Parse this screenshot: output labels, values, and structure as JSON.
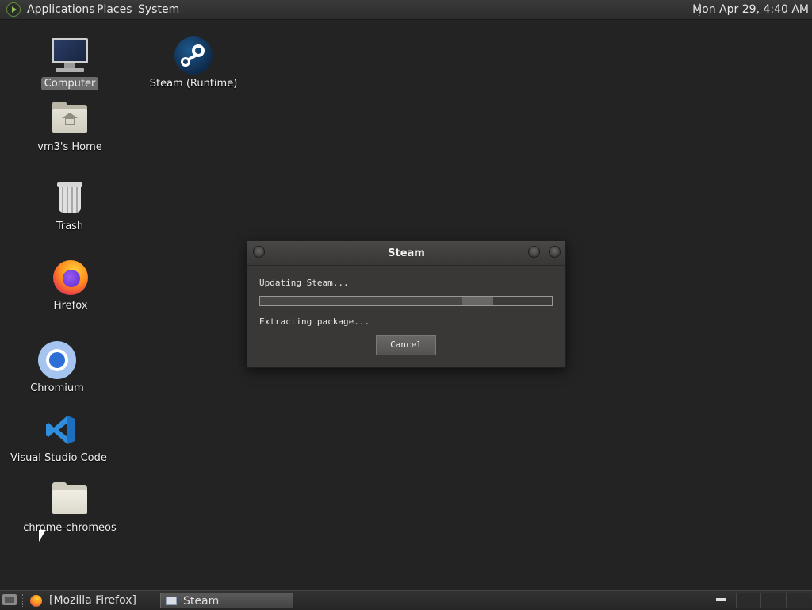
{
  "top_panel": {
    "menus": [
      "Applications",
      "Places",
      "System"
    ],
    "clock": "Mon Apr 29,  4:40 AM"
  },
  "desktop": {
    "icons": [
      {
        "label": "Computer",
        "icon": "computer-icon",
        "selected": true
      },
      {
        "label": "vm3's Home",
        "icon": "home-folder-icon"
      },
      {
        "label": "Trash",
        "icon": "trash-icon"
      },
      {
        "label": "Firefox",
        "icon": "firefox-icon"
      },
      {
        "label": "Chromium",
        "icon": "chromium-icon"
      },
      {
        "label": "Visual Studio Code",
        "icon": "vscode-icon"
      },
      {
        "label": "chrome-chromeos",
        "icon": "folder-icon"
      },
      {
        "label": "Steam (Runtime)",
        "icon": "steam-icon"
      }
    ]
  },
  "dialog": {
    "title": "Steam",
    "status_line": "Updating Steam...",
    "detail_line": "Extracting package...",
    "cancel_label": "Cancel",
    "progress_fraction": 0.8
  },
  "taskbar": {
    "tasks": [
      {
        "label": "[Mozilla Firefox]",
        "active": false
      },
      {
        "label": "Steam",
        "active": true
      }
    ]
  },
  "colors": {
    "desktop_bg": "#232323",
    "dialog_bg": "#3a3836",
    "panel_bg": "#2c2c2c"
  }
}
